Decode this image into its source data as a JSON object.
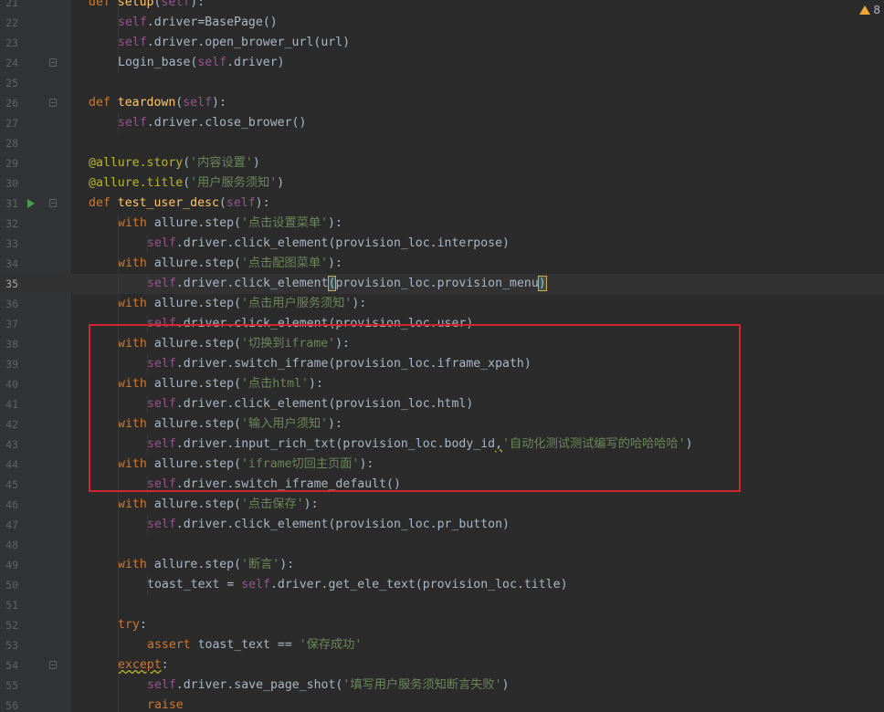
{
  "inspection": {
    "warning_count": "8"
  },
  "current_line": 35,
  "lines": [
    {
      "n": 21,
      "indent": 0,
      "t": [
        [
          "kw",
          "def "
        ],
        [
          "fn",
          "setup"
        ],
        [
          "plain",
          "("
        ],
        [
          "self",
          "self"
        ],
        [
          "plain",
          "):"
        ]
      ]
    },
    {
      "n": 22,
      "indent": 1,
      "t": [
        [
          "self",
          "self"
        ],
        [
          "plain",
          ".driver"
        ],
        [
          "plain",
          "="
        ],
        [
          "plain",
          "BasePage()"
        ]
      ]
    },
    {
      "n": 23,
      "indent": 1,
      "t": [
        [
          "self",
          "self"
        ],
        [
          "plain",
          ".driver.open_brower_url(url)"
        ]
      ]
    },
    {
      "n": 24,
      "indent": 1,
      "t": [
        [
          "plain",
          "Login_base("
        ],
        [
          "self",
          "self"
        ],
        [
          "plain",
          ".driver)"
        ]
      ]
    },
    {
      "n": 25,
      "indent": 0,
      "t": []
    },
    {
      "n": 26,
      "indent": 0,
      "t": [
        [
          "kw",
          "def "
        ],
        [
          "fn",
          "teardown"
        ],
        [
          "plain",
          "("
        ],
        [
          "self",
          "self"
        ],
        [
          "plain",
          "):"
        ]
      ]
    },
    {
      "n": 27,
      "indent": 1,
      "t": [
        [
          "self",
          "self"
        ],
        [
          "plain",
          ".driver.close_brower()"
        ]
      ]
    },
    {
      "n": 28,
      "indent": 0,
      "t": []
    },
    {
      "n": 29,
      "indent": 0,
      "t": [
        [
          "dec",
          "@allure.story"
        ],
        [
          "plain",
          "("
        ],
        [
          "str",
          "'内容设置'"
        ],
        [
          "plain",
          ")"
        ]
      ]
    },
    {
      "n": 30,
      "indent": 0,
      "t": [
        [
          "dec",
          "@allure.title"
        ],
        [
          "plain",
          "("
        ],
        [
          "str",
          "'用户服务须知'"
        ],
        [
          "plain",
          ")"
        ]
      ]
    },
    {
      "n": 31,
      "indent": 0,
      "t": [
        [
          "kw",
          "def "
        ],
        [
          "fn",
          "test_user_desc"
        ],
        [
          "plain",
          "("
        ],
        [
          "self",
          "self"
        ],
        [
          "plain",
          "):"
        ]
      ]
    },
    {
      "n": 32,
      "indent": 1,
      "t": [
        [
          "kw",
          "with "
        ],
        [
          "plain",
          "allure.step("
        ],
        [
          "str",
          "'点击设置菜单'"
        ],
        [
          "plain",
          "):"
        ]
      ]
    },
    {
      "n": 33,
      "indent": 2,
      "t": [
        [
          "self",
          "self"
        ],
        [
          "plain",
          ".driver.click_element(provision_loc.interpose)"
        ]
      ]
    },
    {
      "n": 34,
      "indent": 1,
      "t": [
        [
          "kw",
          "with "
        ],
        [
          "plain",
          "allure.step("
        ],
        [
          "str",
          "'点击配图菜单'"
        ],
        [
          "plain",
          "):"
        ]
      ]
    },
    {
      "n": 35,
      "indent": 2,
      "t": [
        [
          "self",
          "self"
        ],
        [
          "plain",
          ".driver.click_element"
        ],
        [
          "brace",
          "("
        ],
        [
          "plain",
          "provision_loc.provision_menu"
        ],
        [
          "brace",
          ")"
        ]
      ]
    },
    {
      "n": 36,
      "indent": 1,
      "t": [
        [
          "kw",
          "with "
        ],
        [
          "plain",
          "allure.step("
        ],
        [
          "str",
          "'点击用户服务须知'"
        ],
        [
          "plain",
          "):"
        ]
      ]
    },
    {
      "n": 37,
      "indent": 2,
      "t": [
        [
          "self",
          "self"
        ],
        [
          "plain",
          ".driver.click_element(provision_loc.user)"
        ]
      ]
    },
    {
      "n": 38,
      "indent": 1,
      "t": [
        [
          "kw",
          "with "
        ],
        [
          "plain",
          "allure.step("
        ],
        [
          "str",
          "'切换到iframe'"
        ],
        [
          "plain",
          "):"
        ]
      ]
    },
    {
      "n": 39,
      "indent": 2,
      "t": [
        [
          "self",
          "self"
        ],
        [
          "plain",
          ".driver.switch_iframe(provision_loc.iframe_xpath)"
        ]
      ]
    },
    {
      "n": 40,
      "indent": 1,
      "t": [
        [
          "kw",
          "with "
        ],
        [
          "plain",
          "allure.step("
        ],
        [
          "str",
          "'点击html'"
        ],
        [
          "plain",
          "):"
        ]
      ]
    },
    {
      "n": 41,
      "indent": 2,
      "t": [
        [
          "self",
          "self"
        ],
        [
          "plain",
          ".driver.click_element(provision_loc.html)"
        ]
      ]
    },
    {
      "n": 42,
      "indent": 1,
      "t": [
        [
          "kw",
          "with "
        ],
        [
          "plain",
          "allure.step("
        ],
        [
          "str",
          "'输入用户须知'"
        ],
        [
          "plain",
          "):"
        ]
      ]
    },
    {
      "n": 43,
      "indent": 2,
      "t": [
        [
          "self",
          "self"
        ],
        [
          "plain",
          ".driver.input_rich_txt(provision_loc.body_id"
        ],
        [
          "warnu",
          ","
        ],
        [
          "str",
          "'自动化测试测试编写的哈哈哈哈'"
        ],
        [
          "plain",
          ")"
        ]
      ]
    },
    {
      "n": 44,
      "indent": 1,
      "t": [
        [
          "kw",
          "with "
        ],
        [
          "plain",
          "allure.step("
        ],
        [
          "str",
          "'iframe切回主页面'"
        ],
        [
          "plain",
          "):"
        ]
      ]
    },
    {
      "n": 45,
      "indent": 2,
      "t": [
        [
          "self",
          "self"
        ],
        [
          "plain",
          ".driver.switch_iframe_default()"
        ]
      ]
    },
    {
      "n": 46,
      "indent": 1,
      "t": [
        [
          "kw",
          "with "
        ],
        [
          "plain",
          "allure.step("
        ],
        [
          "str",
          "'点击保存'"
        ],
        [
          "plain",
          "):"
        ]
      ]
    },
    {
      "n": 47,
      "indent": 2,
      "t": [
        [
          "self",
          "self"
        ],
        [
          "plain",
          ".driver.click_element(provision_loc.pr_button)"
        ]
      ]
    },
    {
      "n": 48,
      "indent": 0,
      "t": []
    },
    {
      "n": 49,
      "indent": 1,
      "t": [
        [
          "kw",
          "with "
        ],
        [
          "plain",
          "allure.step("
        ],
        [
          "str",
          "'断言'"
        ],
        [
          "plain",
          "):"
        ]
      ]
    },
    {
      "n": 50,
      "indent": 2,
      "t": [
        [
          "plain",
          "toast_text = "
        ],
        [
          "self",
          "self"
        ],
        [
          "plain",
          ".driver.get_ele_text(provision_loc.title)"
        ]
      ]
    },
    {
      "n": 51,
      "indent": 0,
      "t": []
    },
    {
      "n": 52,
      "indent": 1,
      "t": [
        [
          "kw",
          "try"
        ],
        [
          "plain",
          ":"
        ]
      ]
    },
    {
      "n": 53,
      "indent": 2,
      "t": [
        [
          "kw",
          "assert "
        ],
        [
          "plain",
          "toast_text == "
        ],
        [
          "str",
          "'保存成功'"
        ]
      ]
    },
    {
      "n": 54,
      "indent": 1,
      "t": [
        [
          "kwu",
          "except"
        ],
        [
          "plain",
          ":"
        ]
      ]
    },
    {
      "n": 55,
      "indent": 2,
      "t": [
        [
          "self",
          "self"
        ],
        [
          "plain",
          ".driver.save_page_shot("
        ],
        [
          "str",
          "'填写用户服务须知断言失败'"
        ],
        [
          "plain",
          ")"
        ]
      ]
    },
    {
      "n": 56,
      "indent": 2,
      "t": [
        [
          "kw",
          "raise"
        ]
      ]
    }
  ],
  "markers": {
    "run_lines": [
      31
    ],
    "fold_lines": [
      24,
      26,
      31,
      54
    ]
  }
}
